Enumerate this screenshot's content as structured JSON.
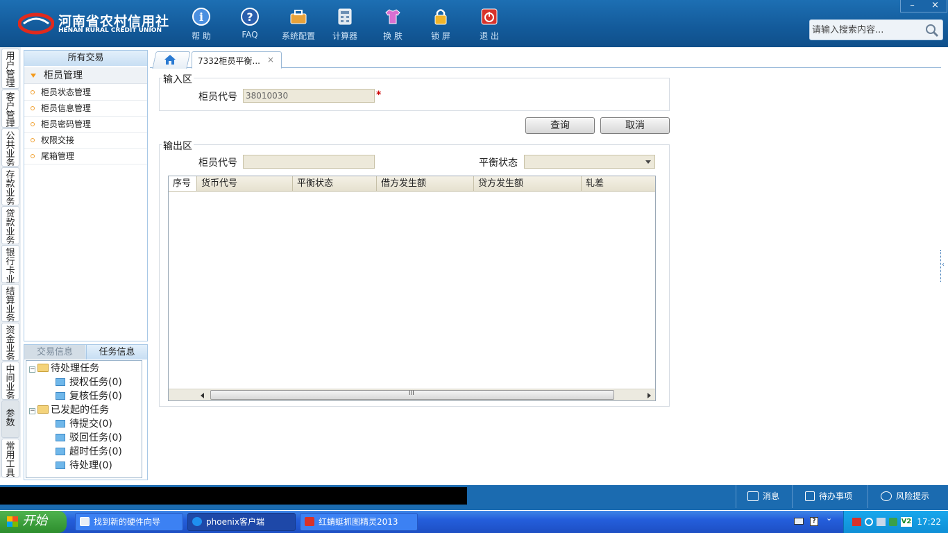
{
  "logo": {
    "cn": "河南省农村信用社",
    "en": "HENAN RURAL CREDIT UNION"
  },
  "toolbar": [
    {
      "label": "帮 助",
      "icon": "help-icon"
    },
    {
      "label": "FAQ",
      "icon": "faq-icon"
    },
    {
      "label": "系统配置",
      "icon": "toolbox-icon"
    },
    {
      "label": "计算器",
      "icon": "calculator-icon"
    },
    {
      "label": "换 肤",
      "icon": "tshirt-icon"
    },
    {
      "label": "锁 屏",
      "icon": "lock-icon"
    },
    {
      "label": "退 出",
      "icon": "power-icon"
    }
  ],
  "window": {
    "minimize": "–",
    "close": "×"
  },
  "search": {
    "placeholder": "请输入搜索内容..."
  },
  "vtabs": [
    "用户管理",
    "客户管理",
    "公共业务",
    "存款业务",
    "贷款业务",
    "银行卡业务",
    "结算业务",
    "资金业务",
    "中间业务",
    "参数",
    "常用工具"
  ],
  "nav": {
    "header": "所有交易",
    "group": "柜员管理",
    "items": [
      "柜员状态管理",
      "柜员信息管理",
      "柜员密码管理",
      "权限交接",
      "尾箱管理"
    ]
  },
  "tasks": {
    "tabs": [
      "交易信息",
      "任务信息"
    ],
    "pending": "待处理任务",
    "pending_items": [
      "授权任务(0)",
      "复核任务(0)"
    ],
    "initiated": "已发起的任务",
    "initiated_items": [
      "待提交(0)",
      "驳回任务(0)",
      "超时任务(0)",
      "待处理(0)"
    ]
  },
  "tabs": {
    "doc": "7332柜员平衡...",
    "close": "×"
  },
  "input_area": {
    "legend": "输入区",
    "teller_label": "柜员代号",
    "teller_value": "38010030",
    "required": "*"
  },
  "buttons": {
    "query": "查询",
    "cancel": "取消"
  },
  "output_area": {
    "legend": "输出区",
    "teller_label": "柜员代号",
    "balance_label": "平衡状态",
    "columns": [
      "序号",
      "货币代号",
      "平衡状态",
      "借方发生额",
      "贷方发生额",
      "轧差"
    ],
    "rows": []
  },
  "statusbar": {
    "message": "消息",
    "todo": "待办事项",
    "risk": "风险提示"
  },
  "taskbar": {
    "start": "开始",
    "items": [
      "找到新的硬件向导",
      "phoenix客户端",
      "红蜻蜓抓图精灵2013"
    ],
    "clock": "17:22"
  },
  "colors": {
    "header_blue": "#135a9a",
    "required_red": "#cc0000",
    "accent_orange": "#f49a1b"
  }
}
